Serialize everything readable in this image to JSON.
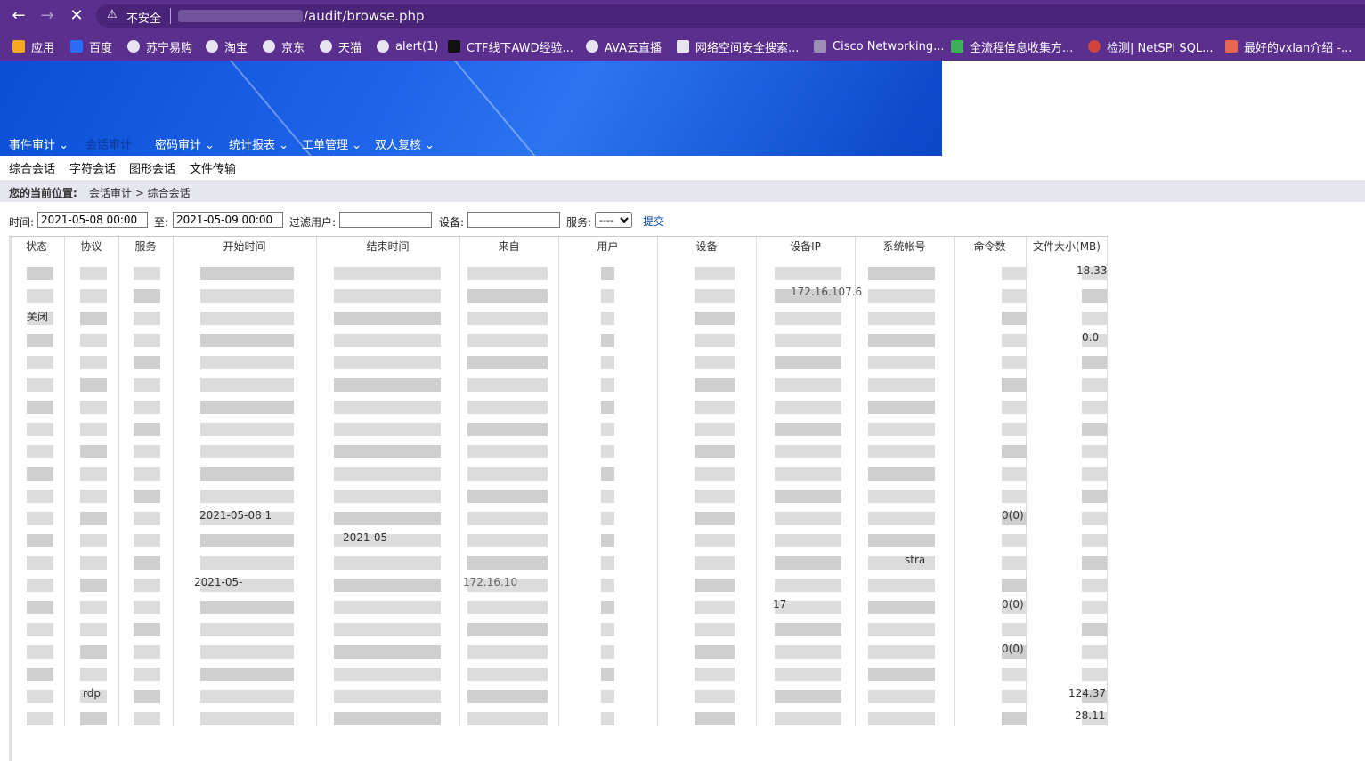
{
  "browser": {
    "security_label": "不安全",
    "url_path": "/audit/browse.php",
    "bookmarks": [
      "应用",
      "百度",
      "苏宁易购",
      "淘宝",
      "京东",
      "天猫",
      "alert(1)",
      "CTF线下AWD经验...",
      "AVA云直播",
      "网络空间安全搜索...",
      "Cisco Networking...",
      "全流程信息收集方...",
      "检测| NetSPI SQL...",
      "最好的vxlan介绍 -..."
    ]
  },
  "nav": {
    "main": [
      "事件审计",
      "会话审计",
      "密码审计",
      "统计报表",
      "工单管理",
      "双人复核"
    ],
    "sub": [
      "综合会话",
      "字符会话",
      "图形会话",
      "文件传输"
    ]
  },
  "breadcrumb": {
    "label": "您的当前位置:",
    "path": "会话审计 > 综合会话"
  },
  "filters": {
    "time_label": "时间:",
    "time_from": "2021-05-08 00:00",
    "to_label": "至:",
    "time_to": "2021-05-09 00:00",
    "user_label": "过滤用户:",
    "user_value": "",
    "device_label": "设备:",
    "device_value": "",
    "service_label": "服务:",
    "service_value": "----",
    "submit_label": "提交"
  },
  "table": {
    "headers": [
      "状态",
      "协议",
      "服务",
      "开始时间",
      "结束时间",
      "来自",
      "用户",
      "设备",
      "设备IP",
      "系统帐号",
      "命令数",
      "文件大小(MB)"
    ],
    "visible_fragments": {
      "status": "关闭",
      "protocol": "rdp",
      "start_partial": "2021-05-08 1",
      "start_partial2": "2021-05-",
      "end_partial": "2021-05",
      "from_partial": "172.16.10",
      "device_ip_partial": "17",
      "device_ip_partial2": "172.16.107.6",
      "sys_account_partial": "stra",
      "cmd_counts": [
        "0(0)",
        "0(0)",
        "0(0)"
      ],
      "file_sizes": [
        "18.33",
        "0.0",
        "124.37",
        "28.11"
      ]
    }
  }
}
